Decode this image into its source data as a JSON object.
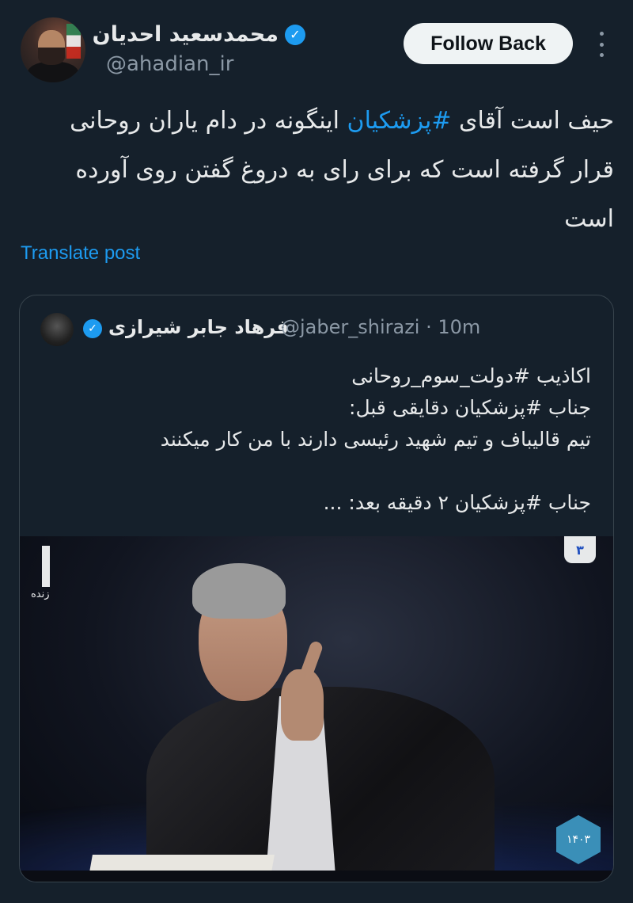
{
  "author": {
    "name": "محمدسعید احدیان",
    "handle": "@ahadian_ir"
  },
  "actions": {
    "follow_label": "Follow Back"
  },
  "tweet": {
    "segments": [
      {
        "text": "حیف است آقای ",
        "hashtag": false
      },
      {
        "text": "#پزشکیان",
        "hashtag": true
      },
      {
        "text": " اینگونه در دام یاران روحانی قرار گرفته است که برای رای  به دروغ گفتن روی آورده است",
        "hashtag": false
      }
    ],
    "translate_label": "Translate post"
  },
  "quote": {
    "name": "فرهاد جابر شیرازی",
    "handle": "@jaber_shirazi",
    "separator": "·",
    "time": "10m",
    "lines": [
      "اکاذیب #دولت_سوم_روحانی",
      "جناب #پزشکیان دقایقی قبل:",
      "تیم قالیباف و تیم شهید رئیسی دارند با من کار میکنند",
      "",
      "جناب #پزشکیان ۲ دقیقه بعد: ..."
    ],
    "image": {
      "live_label": "زنده",
      "channel_number": "۳",
      "logo_text": "۱۴۰۳"
    }
  },
  "colors": {
    "background": "#15202b",
    "accent": "#1d9bf0",
    "text": "#e7e9ea",
    "muted": "#8b98a5",
    "border": "#38444d"
  },
  "icons": [
    "verified-badge-icon",
    "more-options-icon"
  ]
}
